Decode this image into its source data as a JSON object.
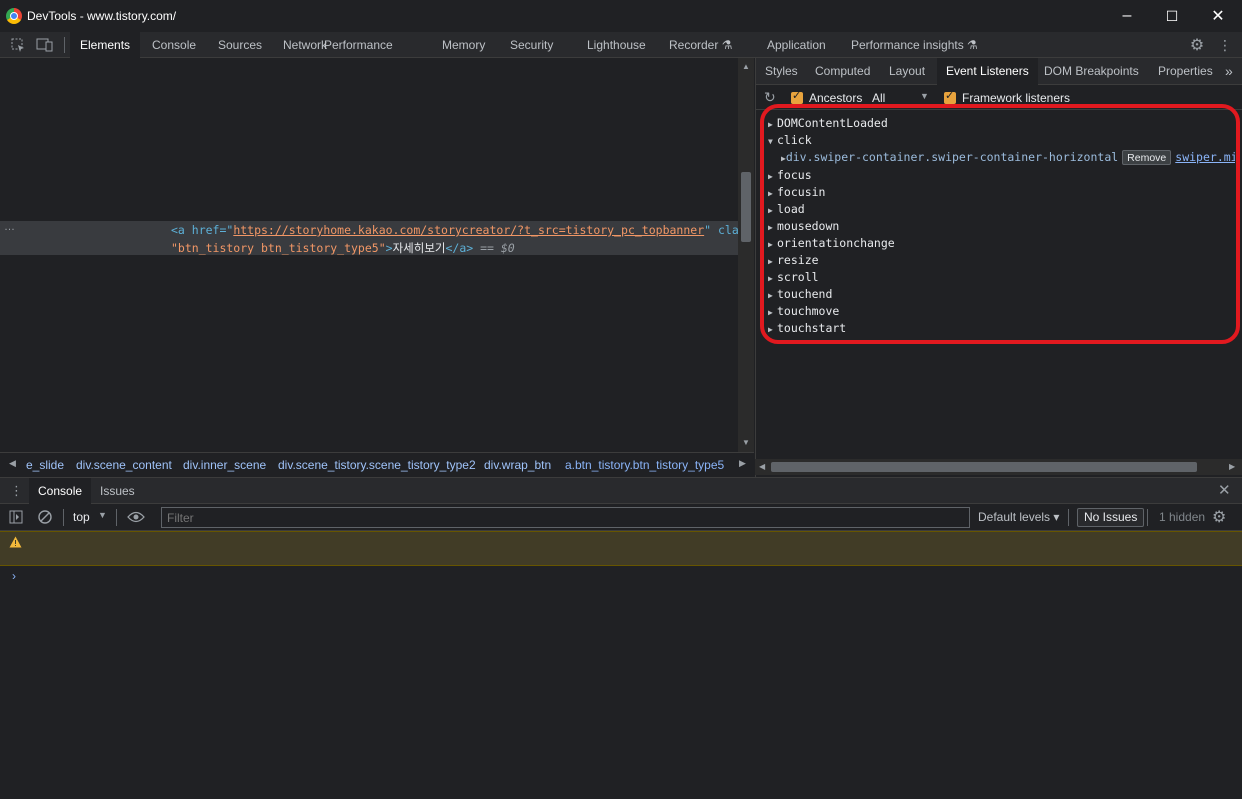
{
  "window": {
    "title": "DevTools - www.tistory.com/",
    "controls": [
      "–",
      "☐",
      "✕"
    ]
  },
  "main_tabs": [
    {
      "label": "Elements",
      "active": true
    },
    {
      "label": "Console"
    },
    {
      "label": "Sources"
    },
    {
      "label": "Network"
    },
    {
      "label": "Performance"
    },
    {
      "label": "Memory"
    },
    {
      "label": "Security"
    },
    {
      "label": "Lighthouse"
    },
    {
      "label": "Recorder ⚗"
    },
    {
      "label": "Application"
    },
    {
      "label": "Performance insights ⚗"
    }
  ],
  "elements": {
    "dots": "…",
    "line1": {
      "open": "<a href=\"",
      "href": "https://storyhome.kakao.com/storycreator/?t_src=tistory_pc_topbanner",
      "close": "\" class="
    },
    "line2": {
      "class_val": "\"btn_tistory btn_tistory_type5\"",
      "gt": ">",
      "text": "자세히보기",
      "end_tag": "</a>",
      "eq": " == $0"
    }
  },
  "breadcrumb": [
    "e_slide",
    "div.scene_content",
    "div.inner_scene",
    "div.scene_tistory.scene_tistory_type2",
    "div.wrap_btn",
    "a.btn_tistory.btn_tistory_type5"
  ],
  "sidebar": {
    "tabs": [
      "Styles",
      "Computed",
      "Layout",
      "Event Listeners",
      "DOM Breakpoints",
      "Properties"
    ],
    "more": "»",
    "ancestors_label": "Ancestors",
    "filter_value": "All",
    "framework_label": "Framework listeners",
    "events": [
      "DOMContentLoaded",
      "click",
      "focus",
      "focusin",
      "load",
      "mousedown",
      "orientationchange",
      "resize",
      "scroll",
      "touchend",
      "touchmove",
      "touchstart"
    ],
    "listener": {
      "node": "div.swiper-container.swiper-container-horizontal",
      "remove_label": "Remove",
      "source": "swiper.min.j"
    }
  },
  "drawer": {
    "tabs": [
      "Console",
      "Issues"
    ],
    "context": "top",
    "filter_placeholder": "Filter",
    "levels": "Default levels ▾",
    "issues_button": "No Issues",
    "hidden": "1 hidden"
  },
  "colors": {
    "highlight": "#e1191f",
    "checkbox": "#e8a33d",
    "warning_bg": "#413c26"
  }
}
